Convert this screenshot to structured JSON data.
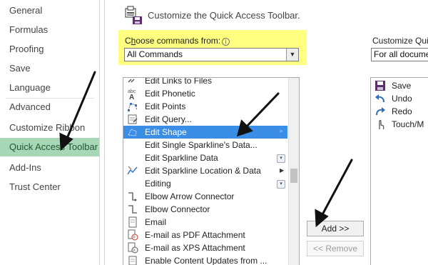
{
  "nav": {
    "items": [
      {
        "label": "General"
      },
      {
        "label": "Formulas"
      },
      {
        "label": "Proofing"
      },
      {
        "label": "Save"
      },
      {
        "label": "Language"
      },
      {
        "label": "Advanced"
      },
      {
        "label": "Customize Ribbon"
      },
      {
        "label": "Quick Access Toolbar"
      },
      {
        "label": "Add-Ins"
      },
      {
        "label": "Trust Center"
      }
    ],
    "active": "Quick Access Toolbar",
    "active_color": "#a7d7b6"
  },
  "header": {
    "title": "Customize the Quick Access Toolbar.",
    "icon": "qat-customize-icon"
  },
  "choose": {
    "label_prefix": "C",
    "label_underlined": "h",
    "label_rest": "oose commands from:",
    "info_icon": "ⓘ",
    "value": "All Commands",
    "highlight_color": "#ffff80"
  },
  "commands": [
    {
      "label": "Edit Links to Files",
      "icon": "links-icon"
    },
    {
      "label": "Edit Phonetic",
      "icon": "phonetic-icon"
    },
    {
      "label": "Edit Points",
      "icon": "edit-points-icon"
    },
    {
      "label": "Edit Query...",
      "icon": "edit-query-icon"
    },
    {
      "label": "Edit Shape",
      "icon": "edit-shape-icon",
      "selected": true
    },
    {
      "label": "Edit Single Sparkline's Data...",
      "icon": ""
    },
    {
      "label": "Edit Sparkline Data",
      "icon": ""
    },
    {
      "label": "Edit Sparkline Location & Data",
      "icon": "sparkline-location-icon"
    },
    {
      "label": "Editing",
      "icon": ""
    },
    {
      "label": "Elbow Arrow Connector",
      "icon": "elbow-arrow-icon"
    },
    {
      "label": "Elbow Connector",
      "icon": "elbow-connector-icon"
    },
    {
      "label": "Email",
      "icon": "email-icon"
    },
    {
      "label": "E-mail as PDF Attachment",
      "icon": "pdf-attachment-icon"
    },
    {
      "label": "E-mail as XPS Attachment",
      "icon": "xps-attachment-icon"
    },
    {
      "label": "Enable Content Updates from ...",
      "icon": "content-updates-icon"
    }
  ],
  "buttons": {
    "add": "Add >>",
    "remove": "<< Remove"
  },
  "customize_toolbar": {
    "label": "Customize Qui",
    "select_value": "For all docume",
    "items": [
      {
        "label": "Save",
        "icon": "save-icon"
      },
      {
        "label": "Undo",
        "icon": "undo-icon"
      },
      {
        "label": "Redo",
        "icon": "redo-icon"
      },
      {
        "label": "Touch/M",
        "icon": "touch-mode-icon"
      }
    ]
  },
  "selection_color": "#3a8ee6"
}
